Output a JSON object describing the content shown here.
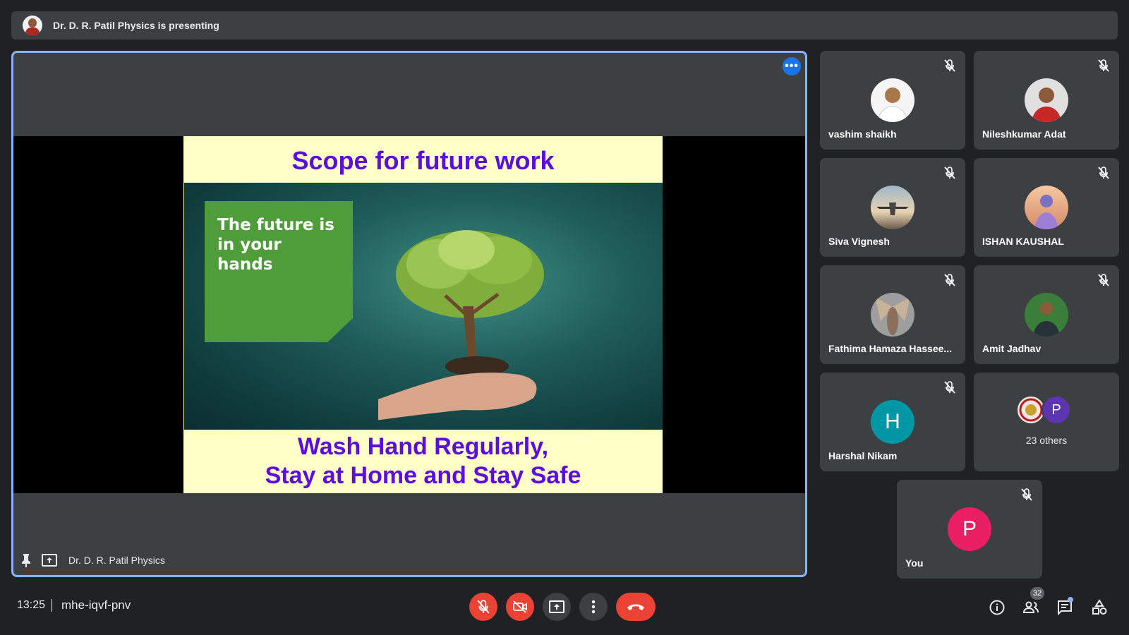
{
  "banner": {
    "text": "Dr. D. R. Patil Physics is presenting"
  },
  "stage": {
    "presenter_name": "Dr. D. R. Patil Physics",
    "more_label": "•••",
    "slide": {
      "title": "Scope for future work",
      "box_line1": "The future is",
      "box_line2": "in your hands",
      "footer_line1": "Wash Hand Regularly,",
      "footer_line2": "Stay at Home and Stay Safe"
    }
  },
  "participants": [
    {
      "name": "vashim shaikh",
      "avatar": "photo"
    },
    {
      "name": "Nileshkumar Adat",
      "avatar": "photo"
    },
    {
      "name": "Siva Vignesh",
      "avatar": "airplane-photo"
    },
    {
      "name": "ISHAN KAUSHAL",
      "avatar": "illustration"
    },
    {
      "name": "Fathima Hamaza Hassee...",
      "avatar": "angel-photo"
    },
    {
      "name": "Amit Jadhav",
      "avatar": "photo"
    },
    {
      "name": "Harshal Nikam",
      "avatar": "letter",
      "letter": "H",
      "color": "#0097a7"
    }
  ],
  "others": {
    "label": "23 others",
    "letter": "P"
  },
  "self": {
    "name": "You",
    "letter": "P",
    "color": "#e91e63"
  },
  "bottom": {
    "time": "13:25",
    "meeting_code": "mhe-iqvf-pnv",
    "people_count": "32"
  },
  "colors": {
    "accent": "#8ab4f8",
    "danger": "#ea4335",
    "tile": "#3c4043",
    "background": "#202124",
    "slide_text": "#5c0ee0"
  }
}
